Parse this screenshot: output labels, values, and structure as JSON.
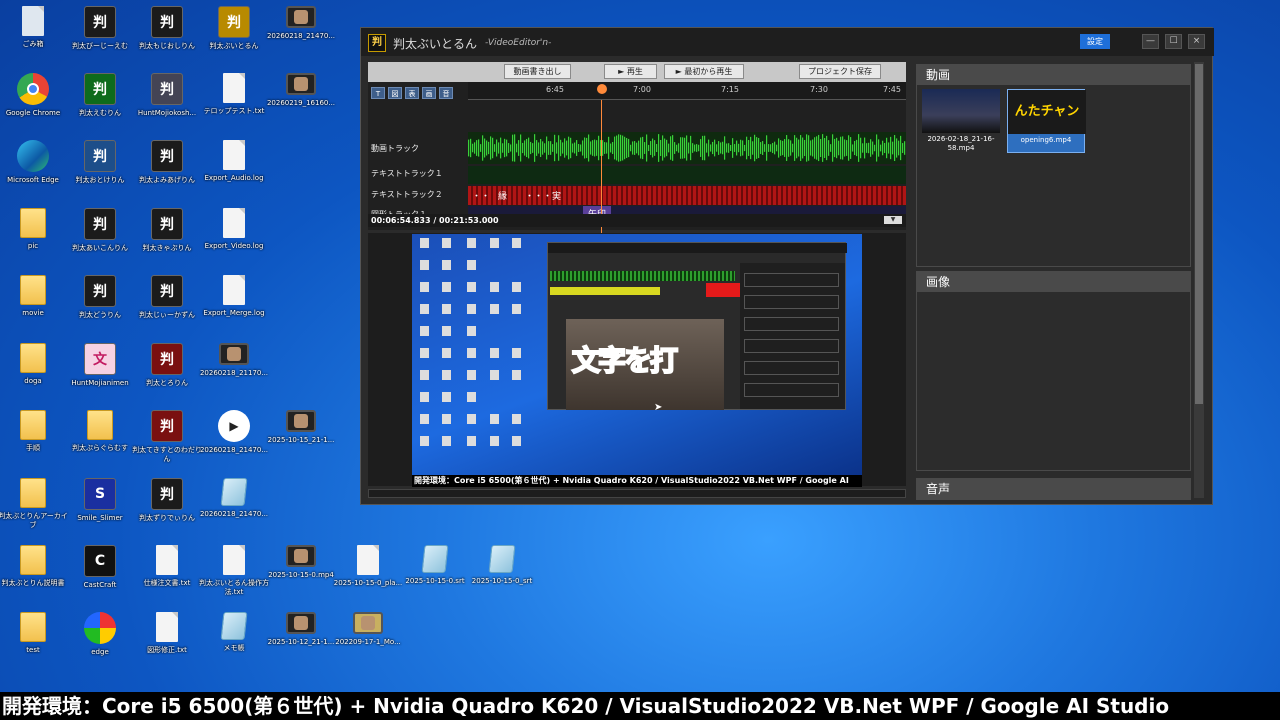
{
  "desktop": {
    "icons": [
      {
        "label": "ごみ箱",
        "icon": "recycle-bin-icon"
      },
      {
        "label": "判太びーじーえむ",
        "icon": "app-icon"
      },
      {
        "label": "判太もじおしりん",
        "icon": "app-icon"
      },
      {
        "label": "判太ぶいとるん",
        "icon": "app-icon"
      },
      {
        "label": "20260218_21470...",
        "icon": "video-file-icon"
      },
      {
        "label": "Google Chrome",
        "icon": "chrome-icon"
      },
      {
        "label": "判太えむりん",
        "icon": "app-icon"
      },
      {
        "label": "HuntMojiokosh...",
        "icon": "app-icon"
      },
      {
        "label": "テロップテスト.txt",
        "icon": "text-file-icon"
      },
      {
        "label": "20260219_16160...",
        "icon": "video-file-icon"
      },
      {
        "label": "Microsoft Edge",
        "icon": "edge-icon"
      },
      {
        "label": "判太おとけりん",
        "icon": "app-icon"
      },
      {
        "label": "判太よみあげりん",
        "icon": "app-icon"
      },
      {
        "label": "Export_Audio.log",
        "icon": "text-file-icon"
      },
      {
        "label": "pic",
        "icon": "folder-icon"
      },
      {
        "label": "判太あいこんりん",
        "icon": "app-icon"
      },
      {
        "label": "判太きゃぷりん",
        "icon": "app-icon"
      },
      {
        "label": "Export_Video.log",
        "icon": "text-file-icon"
      },
      {
        "label": "movie",
        "icon": "folder-icon"
      },
      {
        "label": "判太どうりん",
        "icon": "app-icon"
      },
      {
        "label": "判太じぃーかずん",
        "icon": "app-icon"
      },
      {
        "label": "Export_Merge.log",
        "icon": "text-file-icon"
      },
      {
        "label": "doga",
        "icon": "folder-icon"
      },
      {
        "label": "HuntMojianimen",
        "icon": "app-icon"
      },
      {
        "label": "判太とろりん",
        "icon": "app-icon"
      },
      {
        "label": "20260218_21170...",
        "icon": "video-file-icon"
      },
      {
        "label": "手順",
        "icon": "folder-icon"
      },
      {
        "label": "判太ぷらぐらむす",
        "icon": "folder-icon"
      },
      {
        "label": "判太てきすとのわだりん",
        "icon": "app-icon"
      },
      {
        "label": "20260218_21470...",
        "icon": "play-file-icon"
      },
      {
        "label": "2025-10-15_21-1...",
        "icon": "video-file-icon"
      },
      {
        "label": "判太ぶとりんアーカイブ",
        "icon": "folder-icon"
      },
      {
        "label": "Smile_Slimer",
        "icon": "app-icon"
      },
      {
        "label": "判太ずりでぃりん",
        "icon": "app-icon"
      },
      {
        "label": "20260218_21470...",
        "icon": "subtitle-file-icon"
      },
      {
        "label": "判太ぶとりん説明書",
        "icon": "folder-icon"
      },
      {
        "label": "CastCraft",
        "icon": "castcraft-icon"
      },
      {
        "label": "仕様注文書.txt",
        "icon": "text-file-icon"
      },
      {
        "label": "判太ぶいとるん操作方法.txt",
        "icon": "text-file-icon"
      },
      {
        "label": "2025-10-15-0.mp4",
        "icon": "video-file-icon"
      },
      {
        "label": "2025-10-15-0_pla...",
        "icon": "text-file-icon"
      },
      {
        "label": "2025-10-15-0.srt",
        "icon": "subtitle-file-icon"
      },
      {
        "label": "2025-10-15-0_srt",
        "icon": "subtitle-file-icon"
      },
      {
        "label": "test",
        "icon": "folder-icon"
      },
      {
        "label": "edge",
        "icon": "edge-multicolor-icon"
      },
      {
        "label": "図形修正.txt",
        "icon": "text-file-icon"
      },
      {
        "label": "メモ帳",
        "icon": "subtitle-file-icon"
      },
      {
        "label": "2025-10-12_21-1...",
        "icon": "video-file-icon"
      },
      {
        "label": "202209-17-1_Mo...",
        "icon": "video-file-icon"
      }
    ]
  },
  "window": {
    "title": "判太ぶいとるん",
    "subtitle": "-VideoEditor'n-",
    "settings_label": "設定",
    "minimize": "—",
    "maximize": "☐",
    "close": "×"
  },
  "toolbar": {
    "export_label": "動画書き出し",
    "play_label": "► 再生",
    "play_from_start_label": "► 最初から再生",
    "save_project_label": "プロジェクト保存"
  },
  "timeline": {
    "track_buttons": [
      "T",
      "図",
      "表",
      "画",
      "音"
    ],
    "ticks": [
      "6:45",
      "7:00",
      "7:15",
      "7:30",
      "7:45"
    ],
    "tracks": {
      "video": "動画トラック",
      "text1": "テキストトラック１",
      "text2": "テキストトラック２",
      "shape": "図形トラック１"
    },
    "text2_clips": [
      "・・",
      "縁",
      "・・・",
      "実"
    ],
    "shape_clip": "矢印",
    "timecode": "00:06:54.833 / 00:21:53.000",
    "dropdown": "▼"
  },
  "preview": {
    "caption": "開発環境：Core i5 6500(第６世代) + Nvidia Quadro K620 / VisualStudio2022 VB.Net WPF / Google AI Studio",
    "overlay_text": "文字を打"
  },
  "panels": {
    "video_title": "動画",
    "image_title": "画像",
    "audio_title": "音声",
    "video_items": [
      {
        "name": "2026-02-18_21-16-58.mp4"
      },
      {
        "name": "opening6.mp4"
      }
    ],
    "opening_thumb_text": "んたチャン"
  },
  "bottom_caption": "開発環境：Core i5 6500(第６世代) + Nvidia Quadro K620 / VisualStudio2022 VB.Net WPF / Google AI Studio"
}
